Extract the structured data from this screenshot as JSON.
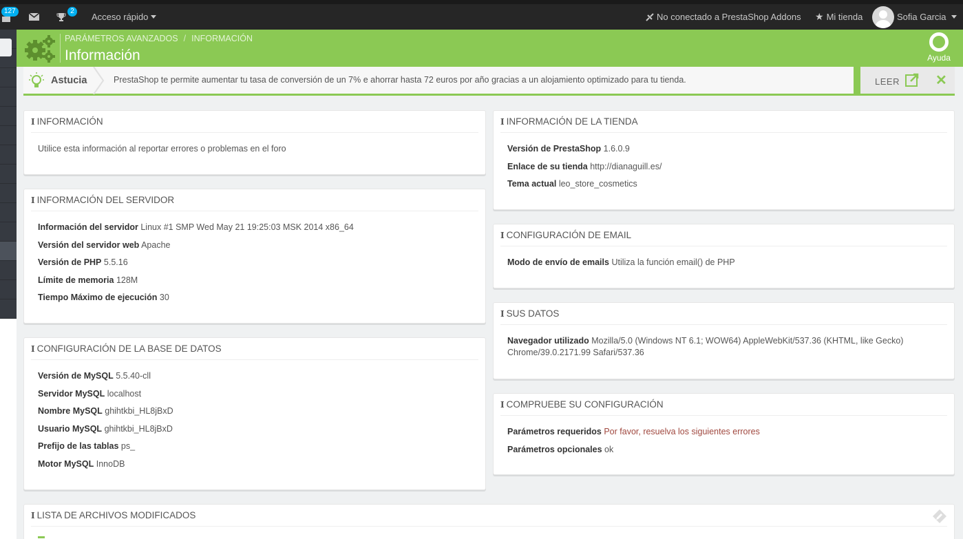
{
  "topbar": {
    "notifications_count": "127",
    "trophy_count": "2",
    "quick_access_label": "Acceso rápido",
    "addons_status": "No conectado a PrestaShop Addons",
    "my_shop_label": "Mi tienda",
    "user_name": "Sofia Garcia"
  },
  "header": {
    "breadcrumb": [
      "PARÁMETROS AVANZADOS",
      "INFORMACIÓN"
    ],
    "title": "Información",
    "help_label": "Ayuda",
    "accent_color": "#8bc954"
  },
  "tip": {
    "label": "Astucia",
    "text": "PrestaShop te permite aumentar tu tasa de conversión de un 7% e ahorrar hasta 72 euros por año gracias a un alojamiento optimizado para tu tienda.",
    "read_label": "LEER",
    "close_glyph": "✕"
  },
  "panels": {
    "info": {
      "title": "INFORMACIÓN",
      "text": "Utilice esta información al reportar errores o problemas en el foro"
    },
    "server": {
      "title": "INFORMACIÓN DEL SERVIDOR",
      "rows": [
        {
          "label": "Información del servidor",
          "value": "Linux #1 SMP Wed May 21 19:25:03 MSK 2014 x86_64"
        },
        {
          "label": "Versión del servidor web",
          "value": "Apache"
        },
        {
          "label": "Versión de PHP",
          "value": "5.5.16"
        },
        {
          "label": "Límite de memoria",
          "value": "128M"
        },
        {
          "label": "Tiempo Máximo de ejecución",
          "value": "30"
        }
      ]
    },
    "database": {
      "title": "CONFIGURACIÓN DE LA BASE DE DATOS",
      "rows": [
        {
          "label": "Versión de MySQL",
          "value": "5.5.40-cll"
        },
        {
          "label": "Servidor MySQL",
          "value": "localhost"
        },
        {
          "label": "Nombre MySQL",
          "value": "ghihtkbi_HL8jBxD"
        },
        {
          "label": "Usuario MySQL",
          "value": "ghihtkbi_HL8jBxD"
        },
        {
          "label": "Prefijo de las tablas",
          "value": "ps_"
        },
        {
          "label": "Motor MySQL",
          "value": "InnoDB"
        }
      ]
    },
    "shop": {
      "title": "INFORMACIÓN DE LA TIENDA",
      "rows": [
        {
          "label": "Versión de PrestaShop",
          "value": "1.6.0.9"
        },
        {
          "label": "Enlace de su tienda",
          "value": "http://dianaguill.es/"
        },
        {
          "label": "Tema actual",
          "value": "leo_store_cosmetics"
        }
      ]
    },
    "email": {
      "title": "CONFIGURACIÓN DE EMAIL",
      "rows": [
        {
          "label": "Modo de envío de emails",
          "value": "Utiliza la función email() de PHP"
        }
      ]
    },
    "your_data": {
      "title": "SUS DATOS",
      "rows": [
        {
          "label": "Navegador utilizado",
          "value": "Mozilla/5.0 (Windows NT 6.1; WOW64) AppleWebKit/537.36 (KHTML, like Gecko) Chrome/39.0.2171.99 Safari/537.36"
        }
      ]
    },
    "check": {
      "title": "COMPRUEBE SU CONFIGURACIÓN",
      "rows": [
        {
          "label": "Parámetros requeridos",
          "value": "Por favor, resuelva los siguientes errores"
        },
        {
          "label": "Parámetros opcionales",
          "value": "ok"
        }
      ]
    },
    "modified_files": {
      "title": "LISTA DE ARCHIVOS MODIFICADOS"
    }
  }
}
